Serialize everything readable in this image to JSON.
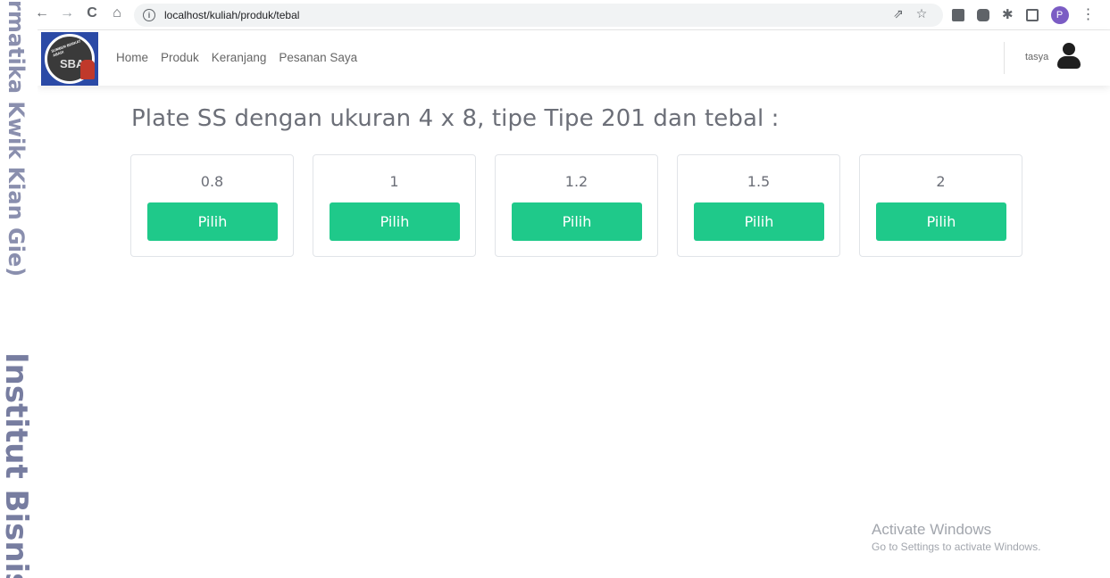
{
  "browser": {
    "url": "localhost/kuliah/produk/tebal",
    "nav": {
      "back": "←",
      "forward": "→",
      "reload": "C",
      "home": "⌂"
    },
    "profile_initial": "P"
  },
  "watermark": {
    "line1": "rmatika Kwik Kian Gie)",
    "line2": "Institut Bisnis"
  },
  "navbar": {
    "logo_text": "SBA",
    "logo_ring_text": "SUMBER BERKAT ABADI",
    "menu": [
      "Home",
      "Produk",
      "Keranjang",
      "Pesanan Saya"
    ],
    "username": "tasya"
  },
  "main": {
    "title": "Plate SS dengan ukuran 4 x 8, tipe Tipe 201 dan tebal :",
    "options": [
      {
        "value": "0.8",
        "button": "Pilih"
      },
      {
        "value": "1",
        "button": "Pilih"
      },
      {
        "value": "1.2",
        "button": "Pilih"
      },
      {
        "value": "1.5",
        "button": "Pilih"
      },
      {
        "value": "2",
        "button": "Pilih"
      }
    ]
  },
  "activate": {
    "line1": "Activate Windows",
    "line2": "Go to Settings to activate Windows."
  },
  "colors": {
    "button_green": "#1fc98a",
    "logo_blue": "#2b4aa6"
  }
}
